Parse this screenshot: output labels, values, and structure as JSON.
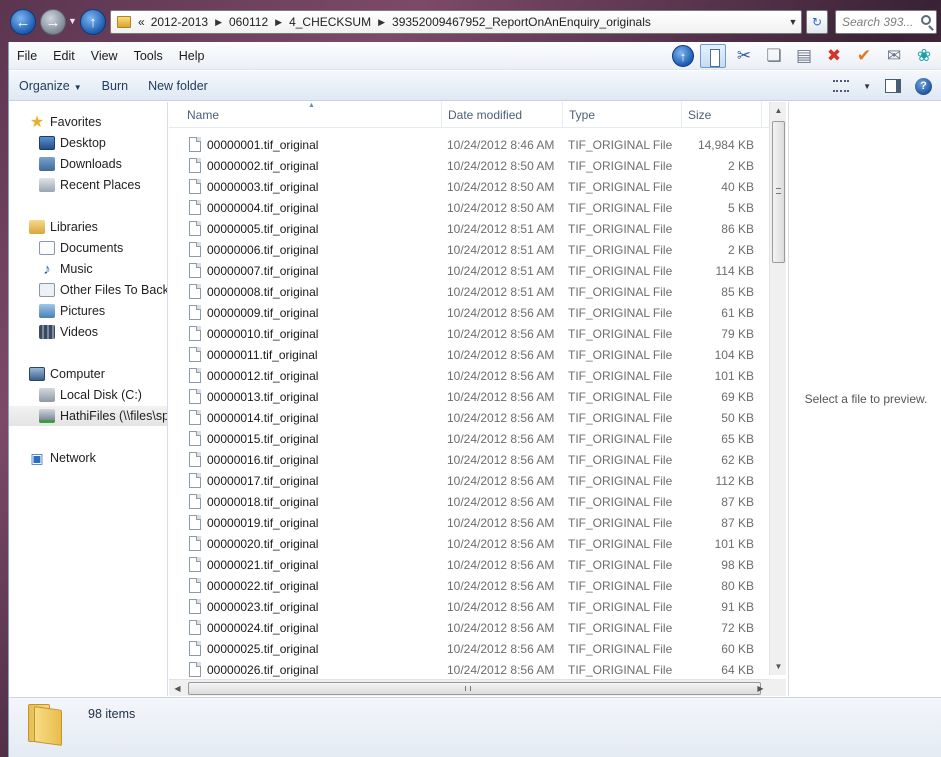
{
  "address_bar": {
    "overflow": "«",
    "breadcrumbs": [
      "2012-2013",
      "060112",
      "4_CHECKSUM",
      "39352009467952_ReportOnAnEnquiry_originals"
    ]
  },
  "search": {
    "placeholder": "Search 393..."
  },
  "menu": [
    "File",
    "Edit",
    "View",
    "Tools",
    "Help"
  ],
  "commands": {
    "organize": "Organize",
    "burn": "Burn",
    "new_folder": "New folder"
  },
  "nav": {
    "favorites": {
      "label": "Favorites",
      "items": [
        "Desktop",
        "Downloads",
        "Recent Places"
      ]
    },
    "libraries": {
      "label": "Libraries",
      "items": [
        "Documents",
        "Music",
        "Other Files To Back U",
        "Pictures",
        "Videos"
      ]
    },
    "computer": {
      "label": "Computer",
      "items": [
        "Local Disk (C:)",
        "HathiFiles (\\\\files\\sp"
      ]
    },
    "network": {
      "label": "Network"
    }
  },
  "columns": {
    "name": "Name",
    "date": "Date modified",
    "type": "Type",
    "size": "Size"
  },
  "files": [
    {
      "name": "00000001.tif_original",
      "date": "10/24/2012 8:46 AM",
      "type": "TIF_ORIGINAL File",
      "size": "14,984 KB"
    },
    {
      "name": "00000002.tif_original",
      "date": "10/24/2012 8:50 AM",
      "type": "TIF_ORIGINAL File",
      "size": "2 KB"
    },
    {
      "name": "00000003.tif_original",
      "date": "10/24/2012 8:50 AM",
      "type": "TIF_ORIGINAL File",
      "size": "40 KB"
    },
    {
      "name": "00000004.tif_original",
      "date": "10/24/2012 8:50 AM",
      "type": "TIF_ORIGINAL File",
      "size": "5 KB"
    },
    {
      "name": "00000005.tif_original",
      "date": "10/24/2012 8:51 AM",
      "type": "TIF_ORIGINAL File",
      "size": "86 KB"
    },
    {
      "name": "00000006.tif_original",
      "date": "10/24/2012 8:51 AM",
      "type": "TIF_ORIGINAL File",
      "size": "2 KB"
    },
    {
      "name": "00000007.tif_original",
      "date": "10/24/2012 8:51 AM",
      "type": "TIF_ORIGINAL File",
      "size": "114 KB"
    },
    {
      "name": "00000008.tif_original",
      "date": "10/24/2012 8:51 AM",
      "type": "TIF_ORIGINAL File",
      "size": "85 KB"
    },
    {
      "name": "00000009.tif_original",
      "date": "10/24/2012 8:56 AM",
      "type": "TIF_ORIGINAL File",
      "size": "61 KB"
    },
    {
      "name": "00000010.tif_original",
      "date": "10/24/2012 8:56 AM",
      "type": "TIF_ORIGINAL File",
      "size": "79 KB"
    },
    {
      "name": "00000011.tif_original",
      "date": "10/24/2012 8:56 AM",
      "type": "TIF_ORIGINAL File",
      "size": "104 KB"
    },
    {
      "name": "00000012.tif_original",
      "date": "10/24/2012 8:56 AM",
      "type": "TIF_ORIGINAL File",
      "size": "101 KB"
    },
    {
      "name": "00000013.tif_original",
      "date": "10/24/2012 8:56 AM",
      "type": "TIF_ORIGINAL File",
      "size": "69 KB"
    },
    {
      "name": "00000014.tif_original",
      "date": "10/24/2012 8:56 AM",
      "type": "TIF_ORIGINAL File",
      "size": "50 KB"
    },
    {
      "name": "00000015.tif_original",
      "date": "10/24/2012 8:56 AM",
      "type": "TIF_ORIGINAL File",
      "size": "65 KB"
    },
    {
      "name": "00000016.tif_original",
      "date": "10/24/2012 8:56 AM",
      "type": "TIF_ORIGINAL File",
      "size": "62 KB"
    },
    {
      "name": "00000017.tif_original",
      "date": "10/24/2012 8:56 AM",
      "type": "TIF_ORIGINAL File",
      "size": "112 KB"
    },
    {
      "name": "00000018.tif_original",
      "date": "10/24/2012 8:56 AM",
      "type": "TIF_ORIGINAL File",
      "size": "87 KB"
    },
    {
      "name": "00000019.tif_original",
      "date": "10/24/2012 8:56 AM",
      "type": "TIF_ORIGINAL File",
      "size": "87 KB"
    },
    {
      "name": "00000020.tif_original",
      "date": "10/24/2012 8:56 AM",
      "type": "TIF_ORIGINAL File",
      "size": "101 KB"
    },
    {
      "name": "00000021.tif_original",
      "date": "10/24/2012 8:56 AM",
      "type": "TIF_ORIGINAL File",
      "size": "98 KB"
    },
    {
      "name": "00000022.tif_original",
      "date": "10/24/2012 8:56 AM",
      "type": "TIF_ORIGINAL File",
      "size": "80 KB"
    },
    {
      "name": "00000023.tif_original",
      "date": "10/24/2012 8:56 AM",
      "type": "TIF_ORIGINAL File",
      "size": "91 KB"
    },
    {
      "name": "00000024.tif_original",
      "date": "10/24/2012 8:56 AM",
      "type": "TIF_ORIGINAL File",
      "size": "72 KB"
    },
    {
      "name": "00000025.tif_original",
      "date": "10/24/2012 8:56 AM",
      "type": "TIF_ORIGINAL File",
      "size": "60 KB"
    },
    {
      "name": "00000026.tif_original",
      "date": "10/24/2012 8:56 AM",
      "type": "TIF_ORIGINAL File",
      "size": "64 KB"
    }
  ],
  "preview": {
    "message": "Select a file to preview."
  },
  "details": {
    "item_count": "98 items"
  }
}
